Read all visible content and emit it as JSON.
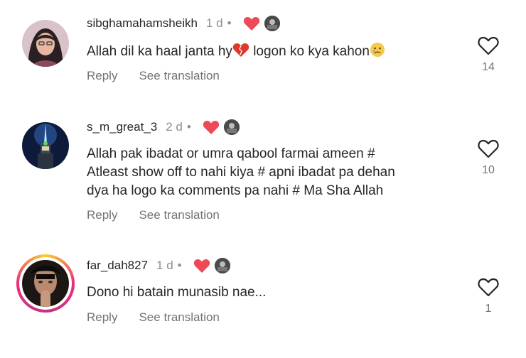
{
  "comments": [
    {
      "username": "sibghamahamsheikh",
      "time": "1 d",
      "text_before": "Allah dil ka haal janta hy",
      "text_after": " logon ko kya kahon",
      "reply_label": "Reply",
      "translate_label": "See translation",
      "like_count": "14"
    },
    {
      "username": "s_m_great_3",
      "time": "2 d",
      "text_lines": [
        "Allah pak ibadat or umra qabool farmai ameen #",
        "Atleast show off to nahi kiya # apni ibadat pa dehan",
        "dya ha logo ka comments pa nahi # Ma Sha Allah"
      ],
      "reply_label": "Reply",
      "translate_label": "See translation",
      "like_count": "10"
    },
    {
      "username": "far_dah827",
      "time": "1 d",
      "text": "Dono hi batain munasib nae...",
      "reply_label": "Reply",
      "translate_label": "See translation",
      "like_count": "1"
    }
  ],
  "colors": {
    "primary_text": "#262626",
    "secondary_text": "#737373",
    "heart_red": "#ed4956"
  },
  "icons": [
    "red-heart-icon",
    "heart-outline-icon",
    "broken-heart-emoji",
    "crying-face-emoji"
  ]
}
